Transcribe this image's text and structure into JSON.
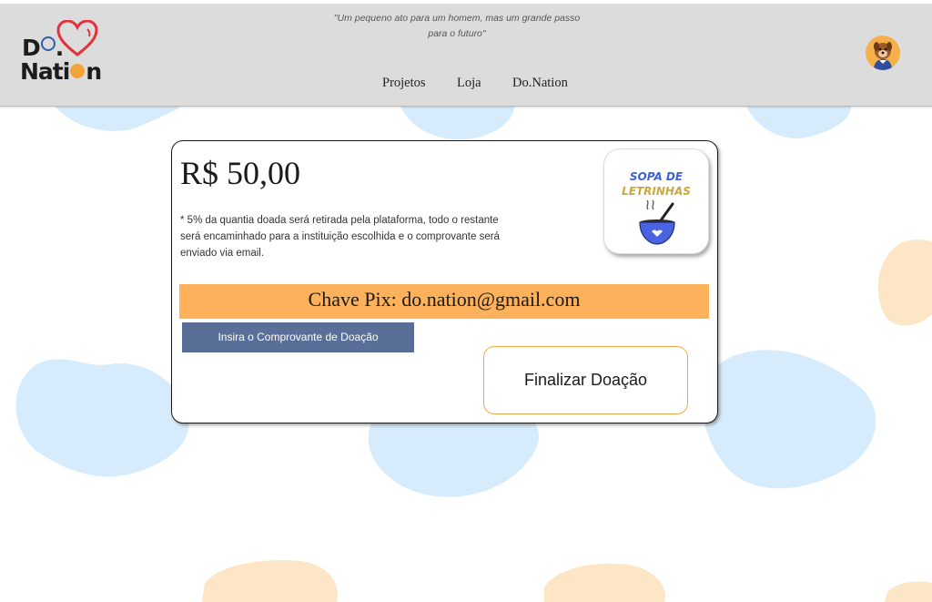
{
  "header": {
    "slogan_line1": "\"Um pequeno ato para um homem, mas um grande passo",
    "slogan_line2": "para o futuro\"",
    "logo_text_line1_a": "D",
    "logo_text_line1_b": ".",
    "logo_text_line2_a": "Nati",
    "logo_text_line2_b": "n",
    "nav": [
      {
        "label": "Projetos"
      },
      {
        "label": "Loja"
      },
      {
        "label": "Do.Nation"
      }
    ]
  },
  "donation": {
    "amount": "R$ 50,00",
    "note": "* 5% da quantia doada será retirada pela plataforma, todo o restante será encaminhado para a instituição escolhida e o comprovante será enviado via email.",
    "org_logo_line1": "SOPA DE",
    "org_logo_line2": "LETRINHAS",
    "pix_key_text": "Chave Pix: do.nation@gmail.com",
    "upload_button_label": "Insira o Comprovante de Doação",
    "finish_button_label": "Finalizar Doação"
  },
  "colors": {
    "header_bg": "#dcdcdc",
    "accent_orange": "#fdb15a",
    "upload_button_bg": "#5a6f97",
    "blob_blue": "#d6ebfb",
    "blob_peach": "#fde6c6",
    "heart_red": "#e0323a"
  },
  "icons": {
    "user_avatar": "dog-avatar-icon",
    "org_logo": "soup-bowl-icon"
  }
}
